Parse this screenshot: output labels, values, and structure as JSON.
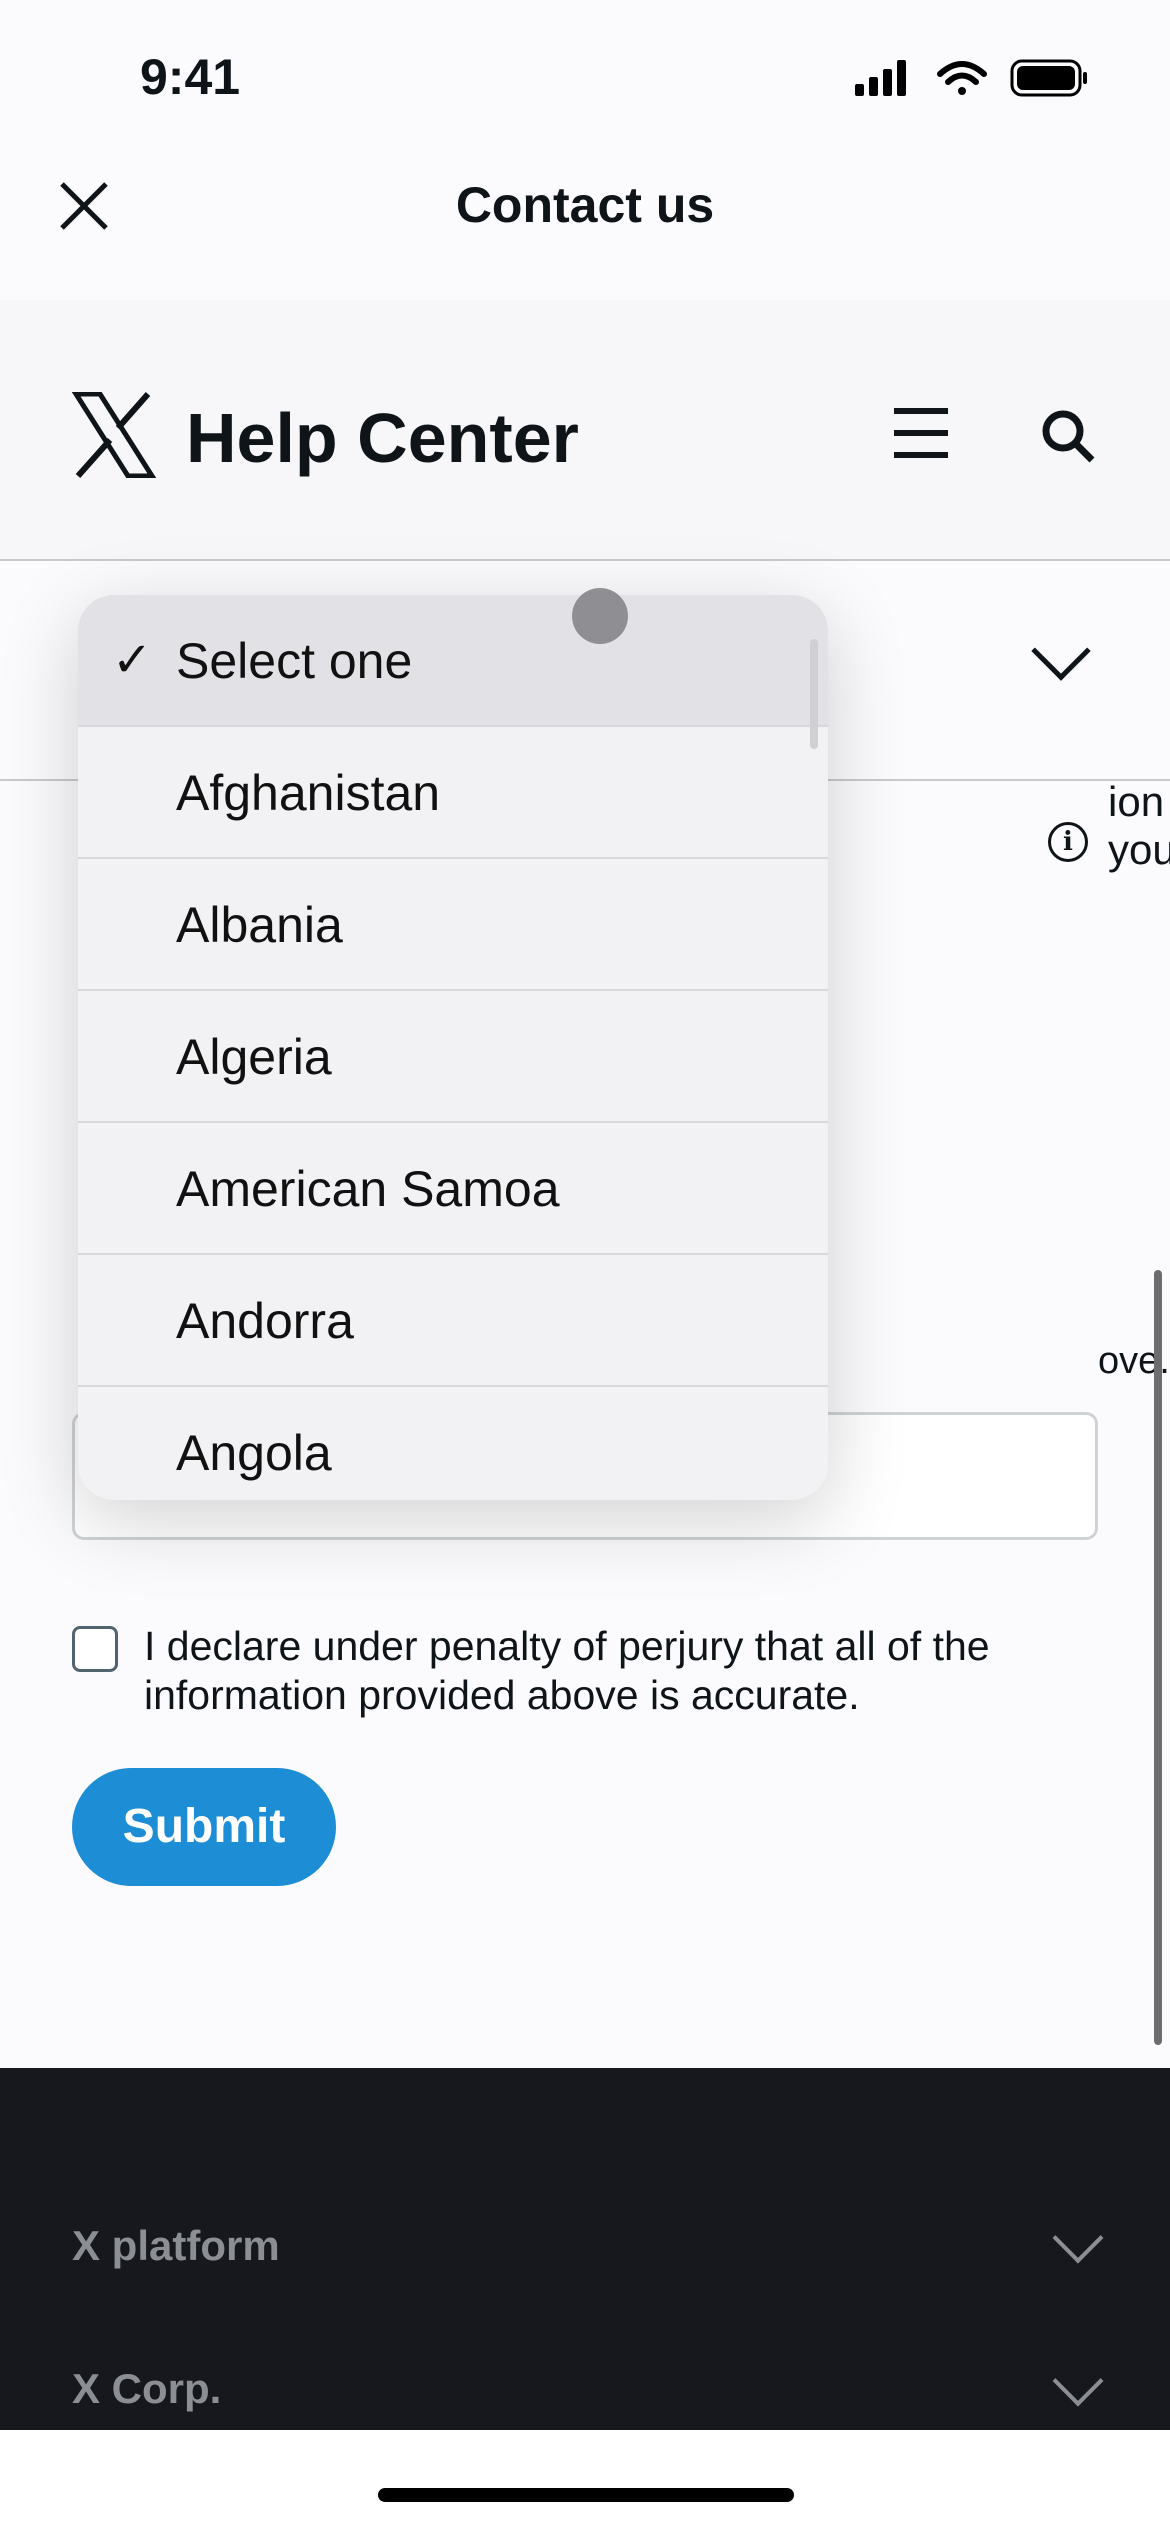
{
  "status_bar": {
    "time": "9:41"
  },
  "nav": {
    "title": "Contact us"
  },
  "help_header": {
    "title": "Help Center"
  },
  "form": {
    "partial_question": "ion you",
    "partial_hint": "ove.",
    "declaration": "I declare under penalty of perjury that all of the information provided above is accurate.",
    "submit_label": "Submit"
  },
  "picker": {
    "options": [
      {
        "label": "Select one",
        "selected": true
      },
      {
        "label": "Afghanistan"
      },
      {
        "label": "Albania"
      },
      {
        "label": "Algeria"
      },
      {
        "label": "American Samoa"
      },
      {
        "label": "Andorra"
      },
      {
        "label": "Angola"
      }
    ],
    "check_glyph": "✓"
  },
  "footer": {
    "items": [
      {
        "label": "X platform"
      },
      {
        "label": "X Corp."
      }
    ]
  },
  "colors": {
    "accent": "#1d8dd6",
    "footer_bg": "#16181d"
  }
}
